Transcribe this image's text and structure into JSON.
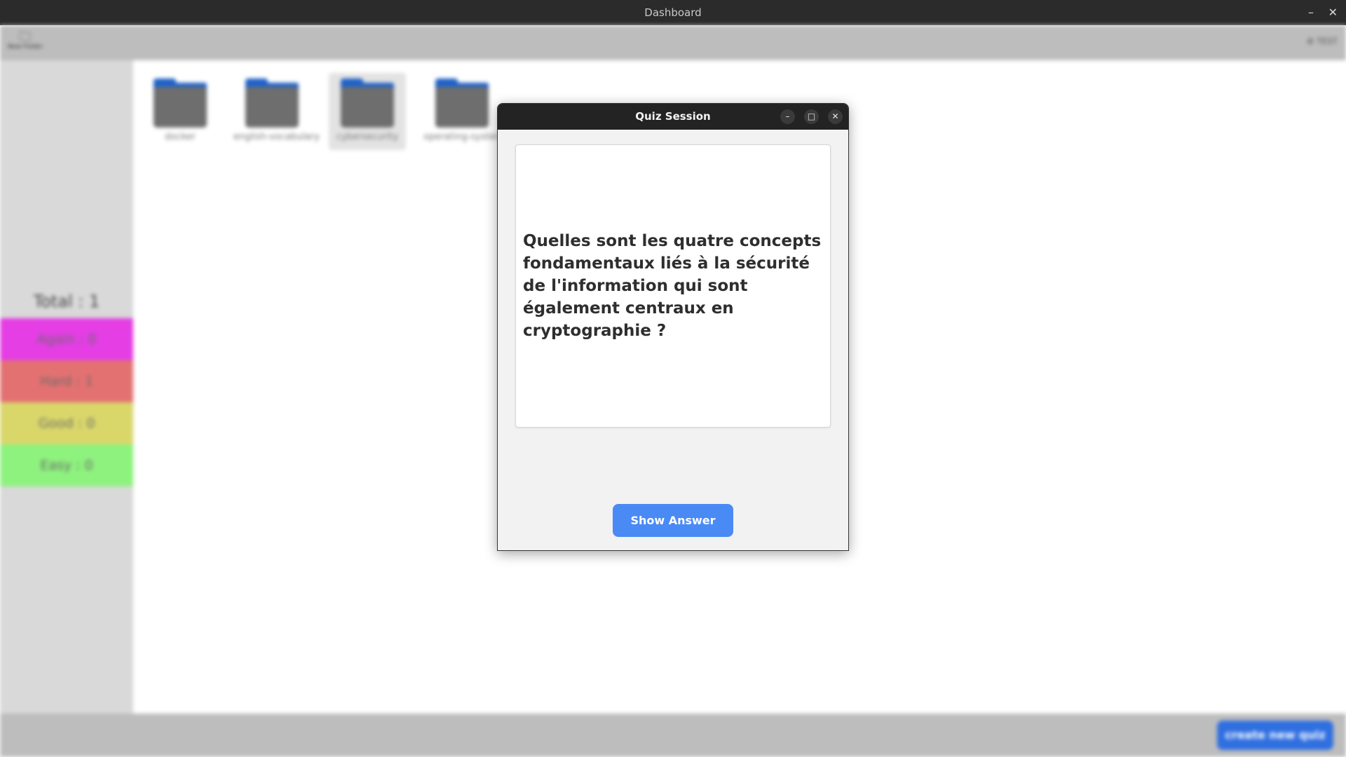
{
  "window": {
    "title": "Dashboard",
    "minimize_glyph": "–",
    "close_glyph": "✕"
  },
  "toolbar": {
    "new_folder_label": "New Folder",
    "new_folder_icon": "🗀",
    "user_label": "⚙ TEST"
  },
  "folders": [
    {
      "name": "docker"
    },
    {
      "name": "english-vocabulary"
    },
    {
      "name": "cybersecurity"
    },
    {
      "name": "operating-system"
    }
  ],
  "stats": {
    "total": "Total : 1",
    "again": "Again : 0",
    "hard": "Hard : 1",
    "good": "Good : 0",
    "easy": "Easy : 0"
  },
  "bottom": {
    "create_label": "create new quiz"
  },
  "quiz": {
    "title": "Quiz Session",
    "minimize_glyph": "–",
    "maximize_glyph": "□",
    "close_glyph": "✕",
    "question": "Quelles sont les quatre concepts fondamentaux liés à la sécurité de l'information qui sont également centraux en cryptographie ?",
    "show_answer_label": "Show Answer"
  },
  "colors": {
    "again": "#e43ee4",
    "hard": "#e37171",
    "good": "#d9d76a",
    "easy": "#8ef27e",
    "accent": "#4a8af4"
  }
}
